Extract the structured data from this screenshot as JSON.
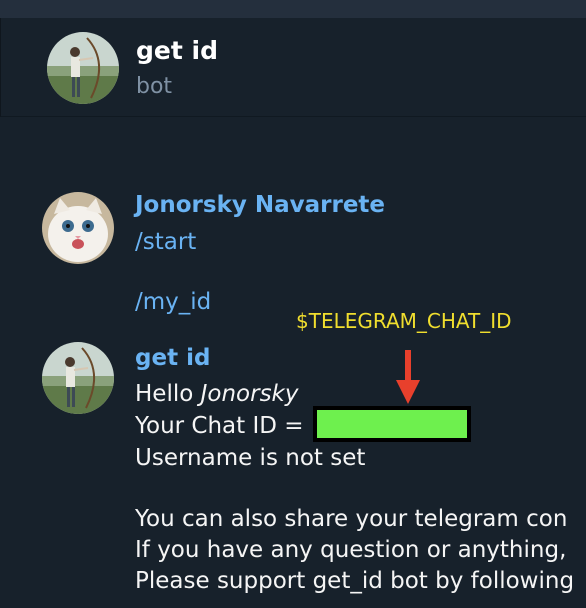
{
  "header": {
    "title": "get id",
    "subtitle": "bot"
  },
  "messages": {
    "user": {
      "sender": "Jonorsky Navarrete",
      "cmd1": "/start",
      "cmd2": "/my_id"
    },
    "bot": {
      "sender": "get id",
      "hello_prefix": "Hello ",
      "hello_name": "Jonorsky",
      "chat_id_label": "Your Chat ID = ",
      "username_line": "Username is not set",
      "p1": "You can also share your telegram con",
      "p2": "If you have any question or anything,",
      "p3": "Please support get_id bot by following"
    }
  },
  "annotation": {
    "text": "$TELEGRAM_CHAT_ID",
    "color": "#f0de2e",
    "arrow_color": "#e8402c",
    "redaction_color": "#6ef04e"
  },
  "colors": {
    "background": "#17212b",
    "accent": "#6ab3f3",
    "muted": "#7f91a4"
  }
}
